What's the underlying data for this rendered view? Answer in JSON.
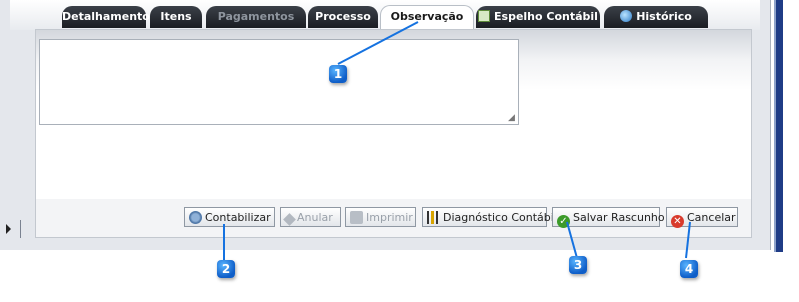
{
  "tabs": [
    {
      "label": "Detalhamento",
      "state": "normal"
    },
    {
      "label": "Itens",
      "state": "normal"
    },
    {
      "label": "Pagamentos",
      "state": "disabled"
    },
    {
      "label": "Processo",
      "state": "normal"
    },
    {
      "label": "Observação",
      "state": "active"
    },
    {
      "label": "Espelho Contábil",
      "state": "normal",
      "icon": "spreadsheet-icon"
    },
    {
      "label": "Histórico",
      "state": "normal",
      "icon": "globe-icon"
    }
  ],
  "observacao": {
    "value": ""
  },
  "buttons": [
    {
      "label": "Contabilizar",
      "icon": "gears-icon",
      "enabled": true
    },
    {
      "label": "Anular",
      "icon": "tag-icon",
      "enabled": false
    },
    {
      "label": "Imprimir",
      "icon": "printer-icon",
      "enabled": false
    },
    {
      "label": "Diagnóstico Contábil",
      "icon": "diagnostic-icon",
      "enabled": true
    },
    {
      "label": "Salvar Rascunho",
      "icon": "check-icon",
      "enabled": true
    },
    {
      "label": "Cancelar",
      "icon": "cancel-icon",
      "enabled": true
    }
  ],
  "callouts": [
    "1",
    "2",
    "3",
    "4"
  ],
  "colors": {
    "tab_dark": "#2a2e35",
    "callout_blue": "#1572e0",
    "accent_bar": "#1f3c86"
  }
}
